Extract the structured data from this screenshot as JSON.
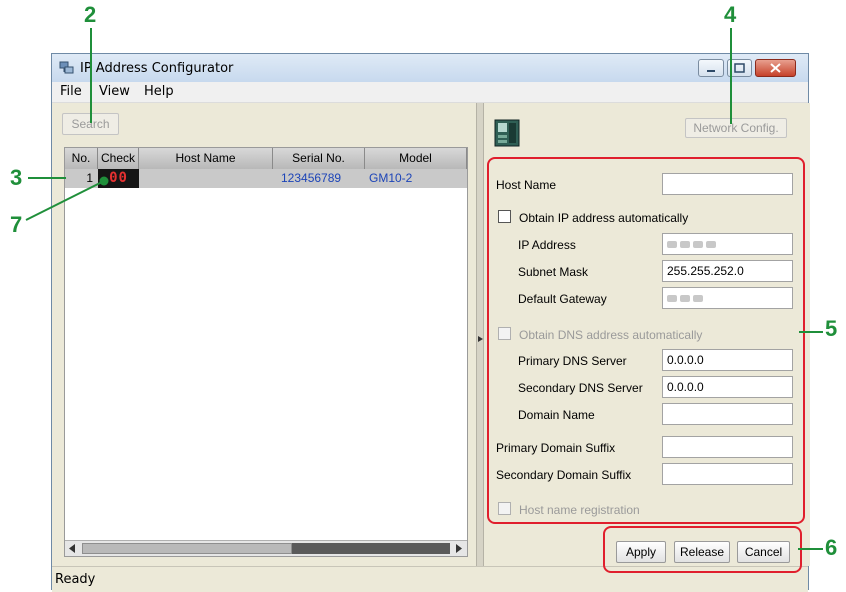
{
  "window": {
    "title": "IP Address Configurator"
  },
  "menu": {
    "file": "File",
    "view": "View",
    "help": "Help"
  },
  "toolbar": {
    "search_label": "Search",
    "network_config_label": "Network Config."
  },
  "table": {
    "headers": [
      "No.",
      "Check",
      "Host Name",
      "Serial No.",
      "Model"
    ],
    "rows": [
      {
        "no": "1",
        "check": "00",
        "host_name": "",
        "serial": "123456789",
        "model": "GM10-2"
      }
    ]
  },
  "form": {
    "host_name_label": "Host Name",
    "host_name_value": "",
    "obtain_ip_label": "Obtain IP address automatically",
    "ip_address_label": "IP Address",
    "subnet_mask_label": "Subnet Mask",
    "subnet_mask_value": "255.255.252.0",
    "default_gateway_label": "Default Gateway",
    "obtain_dns_label": "Obtain DNS address automatically",
    "primary_dns_label": "Primary DNS Server",
    "primary_dns_value": "0.0.0.0",
    "secondary_dns_label": "Secondary DNS Server",
    "secondary_dns_value": "0.0.0.0",
    "domain_name_label": "Domain Name",
    "domain_name_value": "",
    "primary_suffix_label": "Primary Domain Suffix",
    "primary_suffix_value": "",
    "secondary_suffix_label": "Secondary Domain Suffix",
    "secondary_suffix_value": "",
    "host_registration_label": "Host name registration"
  },
  "actions": {
    "apply": "Apply",
    "release": "Release",
    "cancel": "Cancel"
  },
  "status": {
    "text": "Ready"
  },
  "callouts": {
    "c2": "2",
    "c3": "3",
    "c4": "4",
    "c5": "5",
    "c6": "6",
    "c7": "7"
  },
  "colors": {
    "callout_green": "#1f8f3a",
    "callout_red": "#e01f2d",
    "serial_blue": "#1c44b8",
    "check_led": "#e53030"
  }
}
